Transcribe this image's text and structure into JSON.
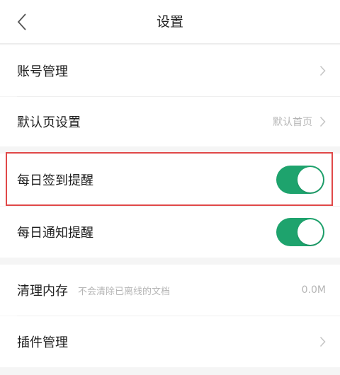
{
  "header": {
    "title": "设置"
  },
  "rows": {
    "account": {
      "label": "账号管理"
    },
    "default_page": {
      "label": "默认页设置",
      "value": "默认首页"
    },
    "daily_checkin": {
      "label": "每日签到提醒",
      "enabled": true
    },
    "daily_notify": {
      "label": "每日通知提醒",
      "enabled": true
    },
    "clear_cache": {
      "label": "清理内存",
      "hint": "不会清除已离线的文档",
      "value": "0.0M"
    },
    "plugins": {
      "label": "插件管理"
    }
  },
  "colors": {
    "toggle_on": "#1ea36d",
    "highlight": "#e04848"
  },
  "icons": {
    "back": "chevron-left-icon",
    "row_arrow": "chevron-right-icon"
  }
}
